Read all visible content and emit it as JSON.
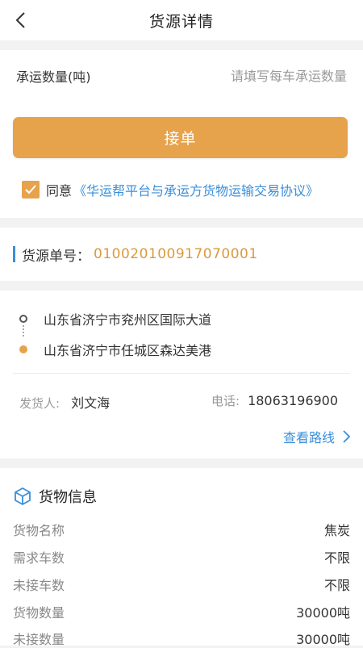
{
  "nav": {
    "title": "货源详情"
  },
  "quantity": {
    "label": "承运数量(吨)",
    "placeholder": "请填写每车承运数量"
  },
  "accept": {
    "button_label": "接单"
  },
  "agreement": {
    "prefix": "同意",
    "link_text": "《华运帮平台与承运方货物运输交易协议》",
    "checked": true
  },
  "order": {
    "label": "货源单号：",
    "number": "010020100917070001"
  },
  "route": {
    "start": "山东省济宁市兖州区国际大道",
    "end": "山东省济宁市任城区森达美港",
    "shipper_label": "发货人:",
    "shipper_name": "刘文海",
    "phone_label": "电话:",
    "phone_number": "18063196900",
    "view_route": "查看路线"
  },
  "goods": {
    "title": "货物信息",
    "rows": [
      {
        "key": "货物名称",
        "value": "焦炭"
      },
      {
        "key": "需求车数",
        "value": "不限"
      },
      {
        "key": "未接车数",
        "value": "不限"
      },
      {
        "key": "货物数量",
        "value": "30000吨"
      },
      {
        "key": "未接数量",
        "value": "30000吨"
      }
    ]
  },
  "colors": {
    "accent_orange": "#e6a34c",
    "link_blue": "#3a8fd9",
    "order_number": "#d99a3e"
  }
}
